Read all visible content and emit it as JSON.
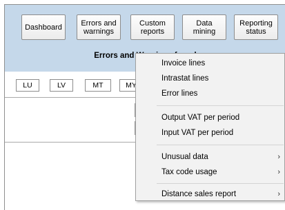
{
  "toolbar": {
    "buttons": [
      {
        "label": "Dashboard"
      },
      {
        "label": "Errors and\nwarnings"
      },
      {
        "label": "Custom\nreports"
      },
      {
        "label": "Data\nmining"
      },
      {
        "label": "Reporting\nstatus"
      }
    ],
    "section_title": "Errors and Warnings found"
  },
  "country_tabs": [
    "LU",
    "LV",
    "MT",
    "MY"
  ],
  "context_menu": {
    "items": [
      {
        "label": "Invoice lines",
        "submenu": false
      },
      {
        "label": "Intrastat lines",
        "submenu": false
      },
      {
        "label": "Error lines",
        "submenu": false
      },
      {
        "label": "Output VAT per period",
        "submenu": false
      },
      {
        "label": "Input VAT per period",
        "submenu": false
      },
      {
        "label": "Unusual data",
        "submenu": true
      },
      {
        "label": "Tax code usage",
        "submenu": true
      },
      {
        "label": "Distance sales report",
        "submenu": true
      }
    ],
    "submenu_arrow": "›"
  }
}
